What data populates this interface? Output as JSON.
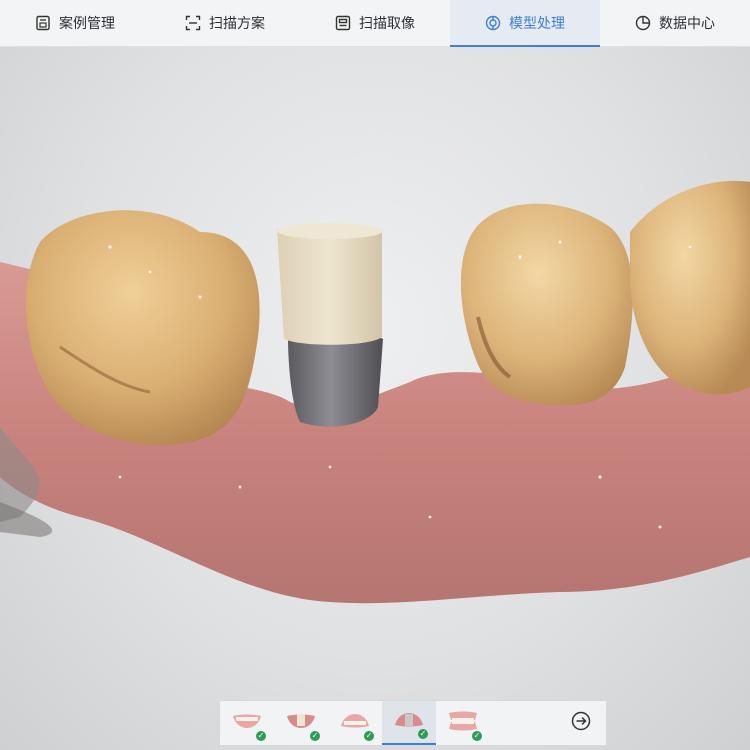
{
  "nav": {
    "tabs": [
      {
        "label": "案例管理",
        "icon": "case-icon",
        "active": false
      },
      {
        "label": "扫描方案",
        "icon": "scan-frame-icon",
        "active": false
      },
      {
        "label": "扫描取像",
        "icon": "scanner-icon",
        "active": false
      },
      {
        "label": "模型处理",
        "icon": "model-icon",
        "active": true
      },
      {
        "label": "数据中心",
        "icon": "pie-chart-icon",
        "active": false
      }
    ]
  },
  "viewport": {
    "content": "3D dental scan model",
    "colors": {
      "gum": "#c97e7a",
      "tooth": "#d9b27c",
      "abutment": "#6e6e72",
      "scanbody_top": "#e8dcc3"
    }
  },
  "steps": {
    "items": [
      {
        "icon": "upper-jaw-icon",
        "done": true,
        "active": false
      },
      {
        "icon": "upper-jaw-scanbody-icon",
        "done": true,
        "active": false
      },
      {
        "icon": "lower-jaw-icon",
        "done": true,
        "active": false
      },
      {
        "icon": "lower-jaw-scanbody-icon",
        "done": true,
        "active": true
      },
      {
        "icon": "bite-icon",
        "done": true,
        "active": false
      }
    ],
    "next_icon": "arrow-right-circle-icon"
  },
  "accent": "#3d7fd4"
}
